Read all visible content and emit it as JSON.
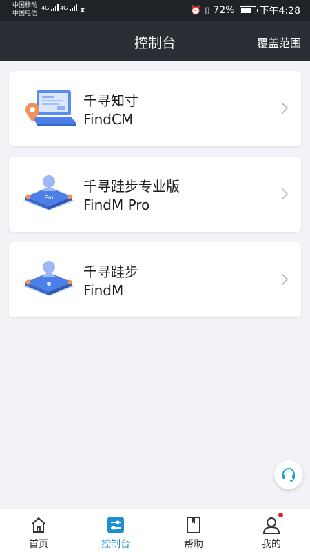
{
  "status_bar": {
    "carrier_1": "中国移动",
    "carrier_2": "中国电信",
    "network_1": "4G",
    "network_2": "4G",
    "battery_percent": "72%",
    "battery_level": 0.72,
    "time": "下午4:28",
    "icons": [
      "hourglass-icon",
      "alarm-icon",
      "vibrate-icon",
      "battery-icon"
    ]
  },
  "header": {
    "title": "控制台",
    "right_action": "覆盖范围"
  },
  "products": [
    {
      "name": "千寻知寸",
      "en_name": "FindCM",
      "icon": "laptop-location-icon"
    },
    {
      "name": "千寻跬步专业版",
      "en_name": "FindM Pro",
      "icon": "platform-pro-icon",
      "icon_text": "Pro"
    },
    {
      "name": "千寻跬步",
      "en_name": "FindM",
      "icon": "platform-icon"
    }
  ],
  "support_button": {
    "icon": "headset-icon"
  },
  "tabbar": {
    "tabs": [
      {
        "label": "首页",
        "icon": "home-icon",
        "active": false
      },
      {
        "label": "控制台",
        "icon": "console-sliders-icon",
        "active": true
      },
      {
        "label": "帮助",
        "icon": "book-icon",
        "active": false
      },
      {
        "label": "我的",
        "icon": "user-icon",
        "active": false,
        "badge": true
      }
    ]
  },
  "colors": {
    "header_bg": "#2a2f35",
    "status_bg": "#1e2328",
    "page_bg": "#f2f2f7",
    "accent": "#1b8fd0",
    "badge": "#e02020",
    "icon_blue": "#4d7fe8",
    "icon_orange": "#f0905a"
  }
}
